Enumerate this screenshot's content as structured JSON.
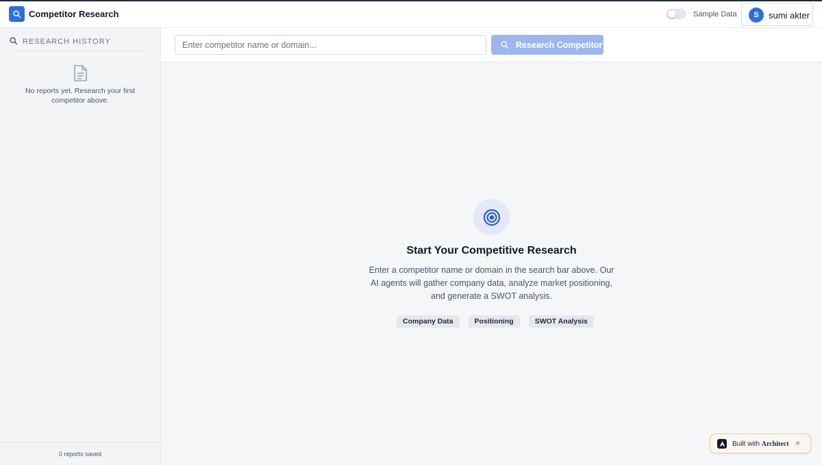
{
  "header": {
    "app_title": "Competitor Research",
    "sample_toggle_label": "Sample Data",
    "sample_toggle_on": false,
    "user_initial": "S",
    "user_name": "sumi akter"
  },
  "sidebar": {
    "history_title": "RESEARCH HISTORY",
    "empty_message": "No reports yet. Research your first competitor above.",
    "footer": "0 reports saved"
  },
  "search": {
    "input_value": "",
    "placeholder": "Enter competitor name or domain...",
    "button_label": "Research Competitor"
  },
  "empty_state": {
    "title": "Start Your Competitive Research",
    "description": "Enter a competitor name or domain in the search bar above. Our AI agents will gather company data, analyze market positioning, and generate a SWOT analysis.",
    "chips": [
      "Company Data",
      "Positioning",
      "SWOT Analysis"
    ]
  },
  "badge": {
    "prefix": "Built with",
    "brand": "Architect",
    "close": "×"
  },
  "colors": {
    "accent": "#2f6fd8",
    "button_disabled": "#9db6ee"
  },
  "icons": {
    "logo": "search-icon",
    "history": "search-icon",
    "empty": "document-icon",
    "button": "search-icon",
    "hero": "target-icon"
  }
}
